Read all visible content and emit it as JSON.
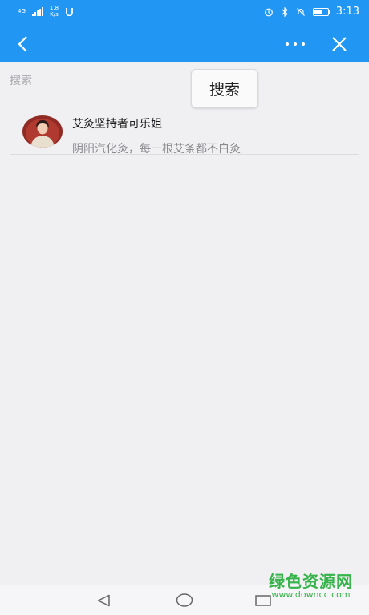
{
  "status_bar": {
    "network_type": "4G",
    "speed_value": "1.8",
    "speed_unit": "K/s",
    "time": "3:13"
  },
  "nav": {
    "back_icon": "chevron-left-icon",
    "more_icon": "more-dots-icon",
    "close_icon": "close-icon"
  },
  "search": {
    "placeholder": "搜索",
    "popup_label": "搜索"
  },
  "results": [
    {
      "title": "艾灸坚持者可乐姐",
      "subtitle": "阴阳汽化灸，每一根艾条都不白灸"
    }
  ],
  "watermark": {
    "text": "绿色资源网",
    "url": "www.downcc.com"
  }
}
